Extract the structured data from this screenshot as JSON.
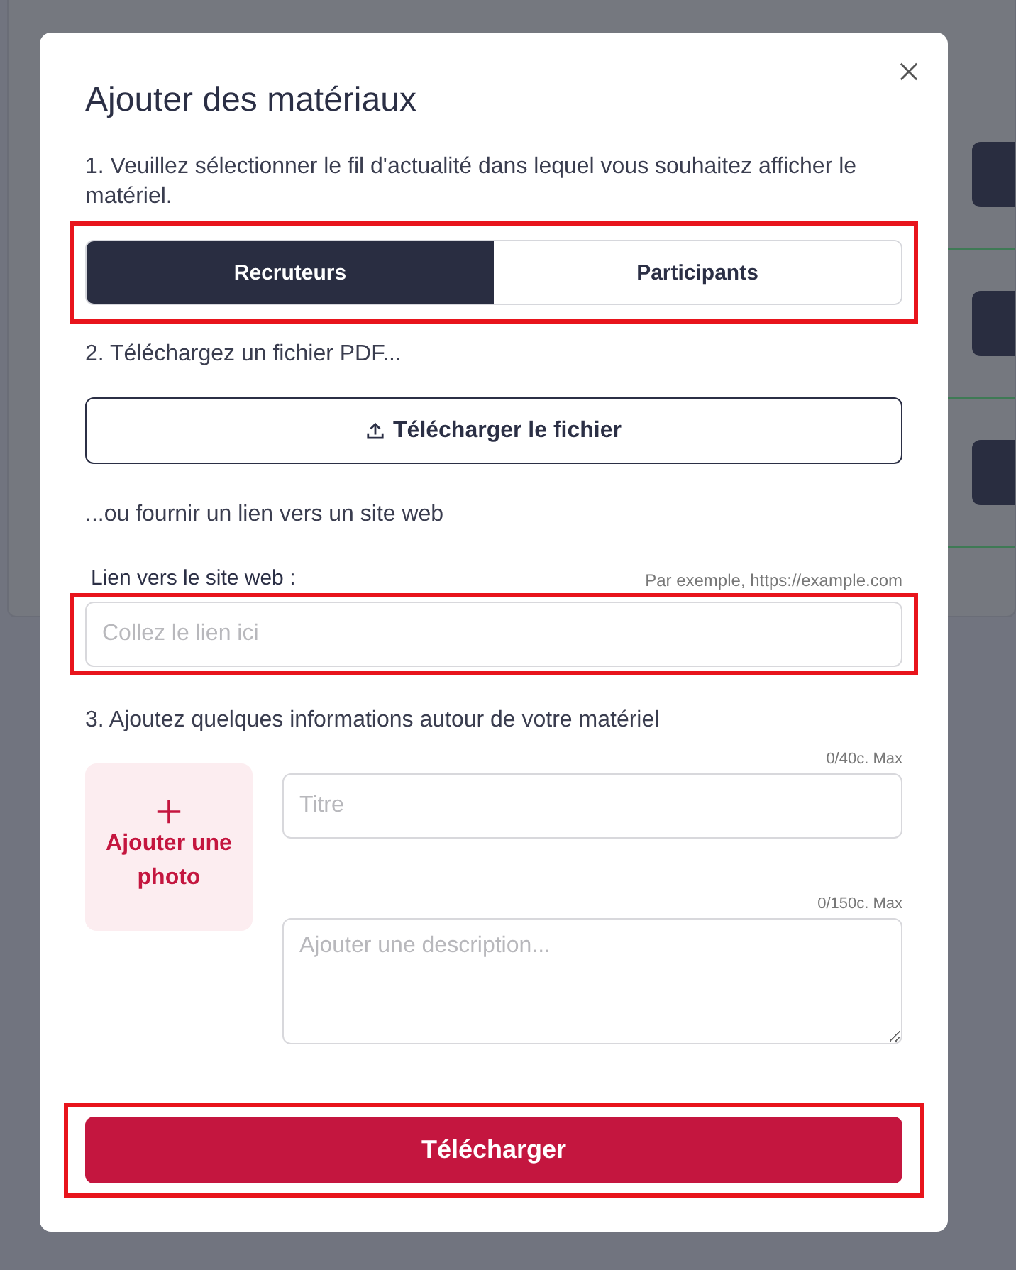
{
  "dialog": {
    "title": "Ajouter des matériaux",
    "step_1": "1. Veuillez sélectionner le fil d'actualité dans lequel vous souhaitez afficher le matériel.",
    "feed_selector": {
      "highlighted": true,
      "options": [
        {
          "label": "Recruteurs",
          "selected": true
        },
        {
          "label": "Participants",
          "selected": false
        }
      ]
    },
    "step_2": "2. Téléchargez un fichier PDF...",
    "upload_button": "Télécharger le fichier",
    "or_text": "...ou fournir un lien vers un site web",
    "link_field": {
      "label": "Lien vers le site web :",
      "hint": "Par exemple, https://example.com",
      "placeholder": "Collez le lien ici",
      "highlighted": true
    },
    "step_3": "3. Ajoutez quelques informations autour de votre matériel",
    "photo_button": "Ajouter une photo",
    "title_field": {
      "counter": "0/40c. Max",
      "placeholder": "Titre"
    },
    "description_field": {
      "counter": "0/150c. Max",
      "placeholder": "Ajouter une description..."
    },
    "submit_button": {
      "label": "Télécharger",
      "highlighted": true
    }
  }
}
